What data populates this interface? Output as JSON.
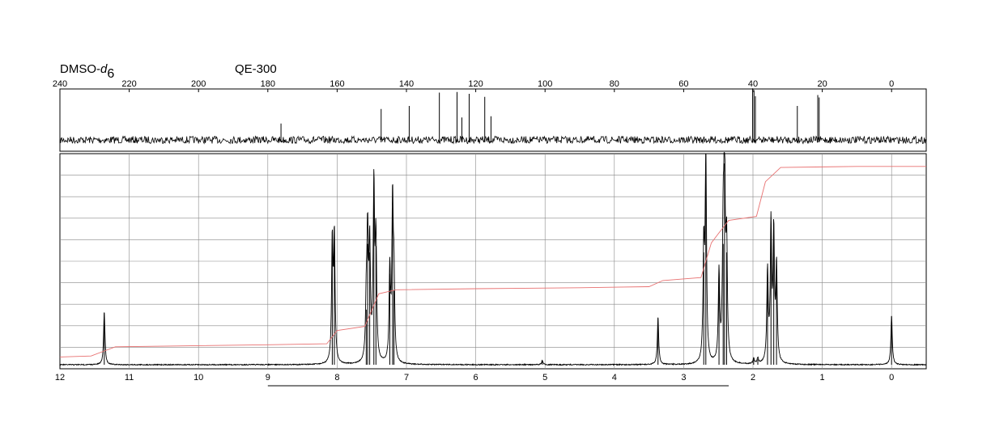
{
  "header": {
    "solvent": "DMSO-",
    "solvent_d": "d",
    "solvent_sub": "6",
    "instrument": "QE-300"
  },
  "colors": {
    "spectrum": "#000000",
    "integral": "#e87070",
    "grid": "#888888",
    "background": "#ffffff"
  },
  "chart_data": [
    {
      "type": "line",
      "name": "13C NMR spectrum",
      "x_unit": "ppm",
      "xlim": [
        240,
        -10
      ],
      "x_ticks": [
        240,
        220,
        200,
        180,
        160,
        140,
        120,
        100,
        80,
        60,
        40,
        20,
        0
      ],
      "x_tick_labels": [
        "240",
        "220",
        "200",
        "180",
        "160",
        "140",
        "120",
        "100",
        "80",
        "60",
        "40",
        "20",
        "0"
      ],
      "grid": false,
      "peaks": [
        {
          "ppm": 176.2,
          "height": 0.27
        },
        {
          "ppm": 147.3,
          "height": 0.51
        },
        {
          "ppm": 139.2,
          "height": 0.56
        },
        {
          "ppm": 130.5,
          "height": 0.78
        },
        {
          "ppm": 125.4,
          "height": 0.79
        },
        {
          "ppm": 124.0,
          "height": 0.37
        },
        {
          "ppm": 121.9,
          "height": 0.76
        },
        {
          "ppm": 117.4,
          "height": 0.71
        },
        {
          "ppm": 115.6,
          "height": 0.39
        },
        {
          "ppm": 40.1,
          "height": 0.85
        },
        {
          "ppm": 39.7,
          "height": 0.82
        },
        {
          "ppm": 39.3,
          "height": 0.72
        },
        {
          "ppm": 27.2,
          "height": 0.56
        },
        {
          "ppm": 21.3,
          "height": 0.74
        },
        {
          "ppm": 20.9,
          "height": 0.7
        }
      ]
    },
    {
      "type": "line",
      "name": "1H NMR spectrum",
      "x_unit": "ppm",
      "xlim": [
        12,
        -0.5
      ],
      "ylim": [
        0,
        1
      ],
      "x_ticks": [
        12,
        11,
        10,
        9,
        8,
        7,
        6,
        5,
        4,
        3,
        2,
        1,
        0
      ],
      "x_tick_labels": [
        "12",
        "11",
        "10",
        "9",
        "8",
        "7",
        "6",
        "5",
        "4",
        "3",
        "2",
        "1",
        "0"
      ],
      "grid": true,
      "peaks": [
        {
          "ppm": 11.36,
          "height": 0.245
        },
        {
          "ppm": 8.07,
          "height": 0.57
        },
        {
          "ppm": 8.04,
          "height": 0.59
        },
        {
          "ppm": 7.58,
          "height": 0.26
        },
        {
          "ppm": 7.56,
          "height": 0.57
        },
        {
          "ppm": 7.53,
          "height": 0.53
        },
        {
          "ppm": 7.47,
          "height": 0.82
        },
        {
          "ppm": 7.44,
          "height": 0.56
        },
        {
          "ppm": 7.24,
          "height": 0.43
        },
        {
          "ppm": 7.2,
          "height": 0.74
        },
        {
          "ppm": 7.18,
          "height": 0.35
        },
        {
          "ppm": 5.04,
          "height": 0.02
        },
        {
          "ppm": 3.37,
          "height": 0.22
        },
        {
          "ppm": 2.71,
          "height": 0.53
        },
        {
          "ppm": 2.68,
          "height": 0.95
        },
        {
          "ppm": 2.49,
          "height": 0.42
        },
        {
          "ppm": 2.43,
          "height": 0.57
        },
        {
          "ppm": 2.41,
          "height": 0.95
        },
        {
          "ppm": 2.38,
          "height": 0.53
        },
        {
          "ppm": 1.99,
          "height": 0.025
        },
        {
          "ppm": 1.93,
          "height": 0.025
        },
        {
          "ppm": 1.79,
          "height": 0.43
        },
        {
          "ppm": 1.74,
          "height": 0.64
        },
        {
          "ppm": 1.7,
          "height": 0.6
        },
        {
          "ppm": 1.66,
          "height": 0.45
        },
        {
          "ppm": 0.0,
          "height": 0.23
        }
      ],
      "integral": [
        [
          12.0,
          0.03
        ],
        [
          11.55,
          0.035
        ],
        [
          11.2,
          0.08
        ],
        [
          9.0,
          0.09
        ],
        [
          8.15,
          0.095
        ],
        [
          8.0,
          0.16
        ],
        [
          7.6,
          0.18
        ],
        [
          7.4,
          0.34
        ],
        [
          7.15,
          0.36
        ],
        [
          6.0,
          0.365
        ],
        [
          4.5,
          0.37
        ],
        [
          3.5,
          0.375
        ],
        [
          3.3,
          0.405
        ],
        [
          2.75,
          0.42
        ],
        [
          2.6,
          0.59
        ],
        [
          2.5,
          0.635
        ],
        [
          2.35,
          0.7
        ],
        [
          1.95,
          0.72
        ],
        [
          1.82,
          0.89
        ],
        [
          1.6,
          0.96
        ],
        [
          0.5,
          0.965
        ],
        [
          -0.5,
          0.965
        ]
      ],
      "integration_bar_range": [
        9.0,
        2.35
      ]
    }
  ]
}
